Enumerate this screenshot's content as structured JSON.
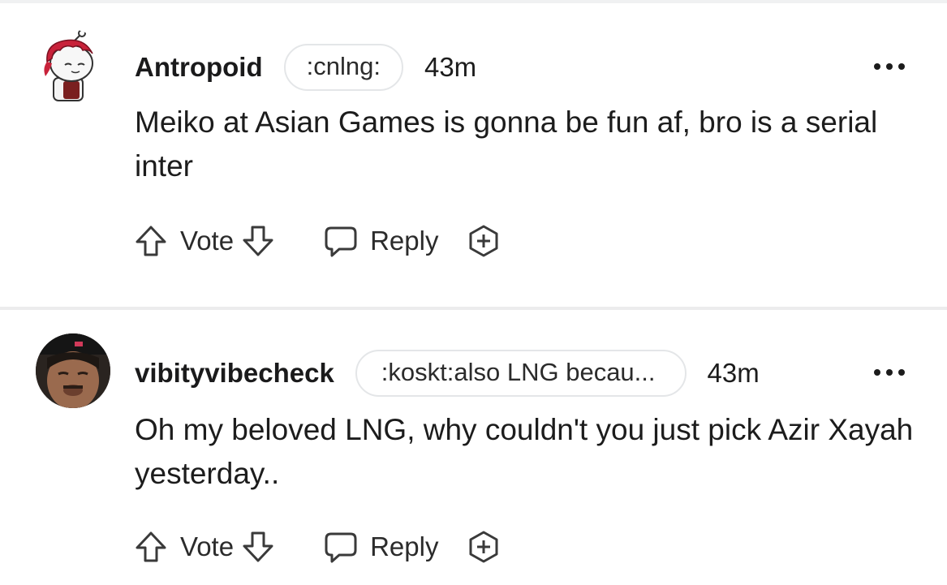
{
  "comments": [
    {
      "username": "Antropoid",
      "flair": ":cnlng:",
      "time": "43m",
      "body": "Meiko at Asian Games is gonna be fun af, bro is a serial inter",
      "vote_label": "Vote",
      "reply_label": "Reply"
    },
    {
      "username": "vibityvibecheck",
      "flair": ":koskt:also LNG becau...",
      "time": "43m",
      "body": "Oh my beloved LNG, why couldn't you just pick Azir Xayah yesterday..",
      "vote_label": "Vote",
      "reply_label": "Reply"
    }
  ],
  "icons": {
    "upvote": "arrow-up-outline",
    "downvote": "arrow-down-outline",
    "reply": "speech-bubble-outline",
    "award": "hexagon-plus-outline",
    "more": "three-dots-horizontal"
  },
  "colors": {
    "text": "#1c1c1c",
    "flair_border": "#e4e6e8",
    "divider": "#ececed",
    "avatar_hair": "#c8223a"
  }
}
